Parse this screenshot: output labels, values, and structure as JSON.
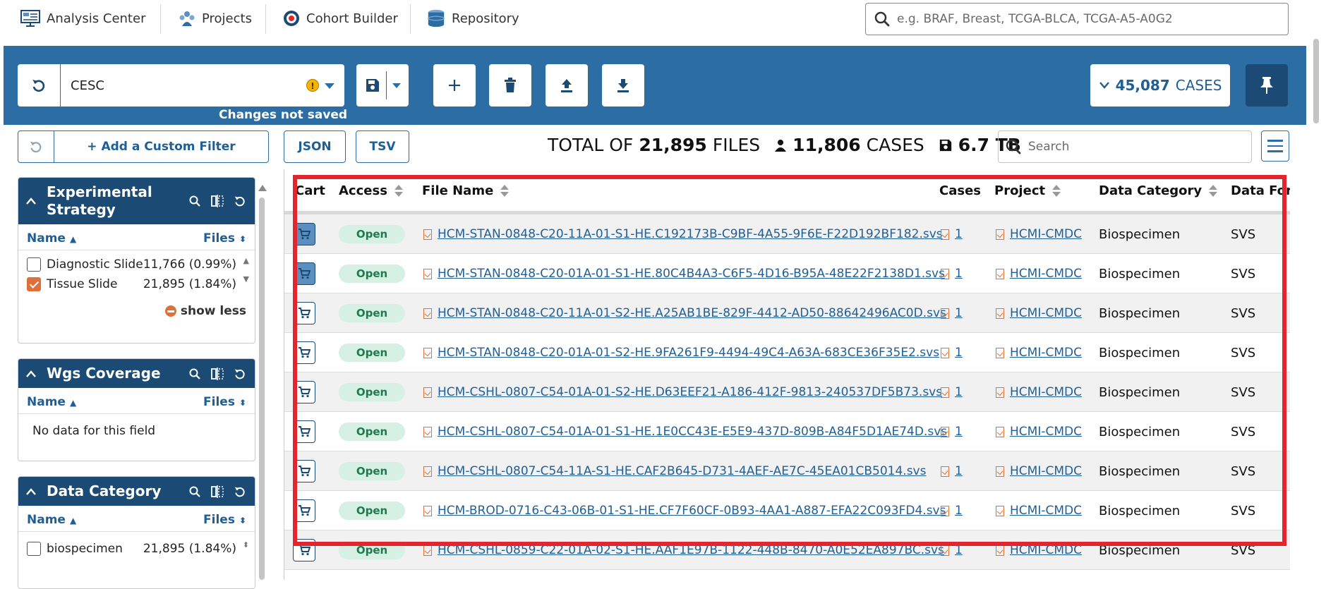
{
  "nav": {
    "items": [
      {
        "label": "Analysis Center",
        "icon": "analysis-center-icon"
      },
      {
        "label": "Projects",
        "icon": "projects-icon"
      },
      {
        "label": "Cohort Builder",
        "icon": "cohort-builder-icon"
      },
      {
        "label": "Repository",
        "icon": "repository-icon"
      }
    ],
    "search_placeholder": "e.g. BRAF, Breast, TCGA-BLCA, TCGA-A5-A0G2"
  },
  "cohort": {
    "name": "CESC",
    "warning": "!",
    "status": "Changes not saved",
    "cases_count": "45,087",
    "cases_label": "CASES"
  },
  "filters": {
    "add_label": "+ Add a Custom Filter",
    "facets": [
      {
        "title": "Experimental Strategy",
        "col_name": "Name",
        "col_files": "Files",
        "rows": [
          {
            "label": "Diagnostic Slide",
            "value": "11,766 (0.99%)",
            "checked": false
          },
          {
            "label": "Tissue Slide",
            "value": "21,895 (1.84%)",
            "checked": true
          }
        ],
        "show_less": "show less"
      },
      {
        "title": "Wgs Coverage",
        "col_name": "Name",
        "col_files": "Files",
        "empty": "No data for this field"
      },
      {
        "title": "Data Category",
        "col_name": "Name",
        "col_files": "Files",
        "rows": [
          {
            "label": "biospecimen",
            "value": "21,895 (1.84%)",
            "checked": false
          }
        ]
      }
    ]
  },
  "table": {
    "json_label": "JSON",
    "tsv_label": "TSV",
    "totals": {
      "prefix": "TOTAL OF",
      "files": "21,895",
      "files_label": "FILES",
      "cases": "11,806",
      "cases_label": "CASES",
      "size": "6.7 TB"
    },
    "search_placeholder": "Search",
    "columns": [
      "Cart",
      "Access",
      "File Name",
      "Cases",
      "Project",
      "Data Category",
      "Data For"
    ],
    "rows": [
      {
        "in_cart": true,
        "access": "Open",
        "file": "HCM-STAN-0848-C20-11A-01-S1-HE.C192173B-C9BF-4A55-9F6E-F22D192BF182.svs",
        "cases": "1",
        "project": "HCMI-CMDC",
        "category": "Biospecimen",
        "format": "SVS"
      },
      {
        "in_cart": true,
        "access": "Open",
        "file": "HCM-STAN-0848-C20-01A-01-S1-HE.80C4B4A3-C6F5-4D16-B95A-48E22F2138D1.svs",
        "cases": "1",
        "project": "HCMI-CMDC",
        "category": "Biospecimen",
        "format": "SVS"
      },
      {
        "in_cart": false,
        "access": "Open",
        "file": "HCM-STAN-0848-C20-11A-01-S2-HE.A25AB1BE-829F-4412-AD50-88642496AC0D.svs",
        "cases": "1",
        "project": "HCMI-CMDC",
        "category": "Biospecimen",
        "format": "SVS"
      },
      {
        "in_cart": false,
        "access": "Open",
        "file": "HCM-STAN-0848-C20-01A-01-S2-HE.9FA261F9-4494-49C4-A63A-683CE36F35E2.svs",
        "cases": "1",
        "project": "HCMI-CMDC",
        "category": "Biospecimen",
        "format": "SVS"
      },
      {
        "in_cart": false,
        "access": "Open",
        "file": "HCM-CSHL-0807-C54-01A-01-S2-HE.D63EEF21-A186-412F-9813-240537DF5B73.svs",
        "cases": "1",
        "project": "HCMI-CMDC",
        "category": "Biospecimen",
        "format": "SVS"
      },
      {
        "in_cart": false,
        "access": "Open",
        "file": "HCM-CSHL-0807-C54-01A-01-S1-HE.1E0CC43E-E5E9-437D-809B-A84F5D1AE74D.svs",
        "cases": "1",
        "project": "HCMI-CMDC",
        "category": "Biospecimen",
        "format": "SVS"
      },
      {
        "in_cart": false,
        "access": "Open",
        "file": "HCM-CSHL-0807-C54-11A-S1-HE.CAF2B645-D731-4AEF-AE7C-45EA01CB5014.svs",
        "cases": "1",
        "project": "HCMI-CMDC",
        "category": "Biospecimen",
        "format": "SVS"
      },
      {
        "in_cart": false,
        "access": "Open",
        "file": "HCM-BROD-0716-C43-06B-01-S1-HE.CF7F60CF-0B93-4AA1-A887-EFA22C093FD4.svs",
        "cases": "1",
        "project": "HCMI-CMDC",
        "category": "Biospecimen",
        "format": "SVS"
      },
      {
        "in_cart": false,
        "access": "Open",
        "file": "HCM-CSHL-0859-C22-01A-02-S1-HE.AAF1E97B-1122-448B-8470-A0E52EA897BC.svs",
        "cases": "1",
        "project": "HCMI-CMDC",
        "category": "Biospecimen",
        "format": "SVS"
      }
    ]
  },
  "colors": {
    "primary": "#2c6ea4",
    "dark": "#1b4a74",
    "accent": "#e0703a",
    "highlight": "#e2252f"
  }
}
